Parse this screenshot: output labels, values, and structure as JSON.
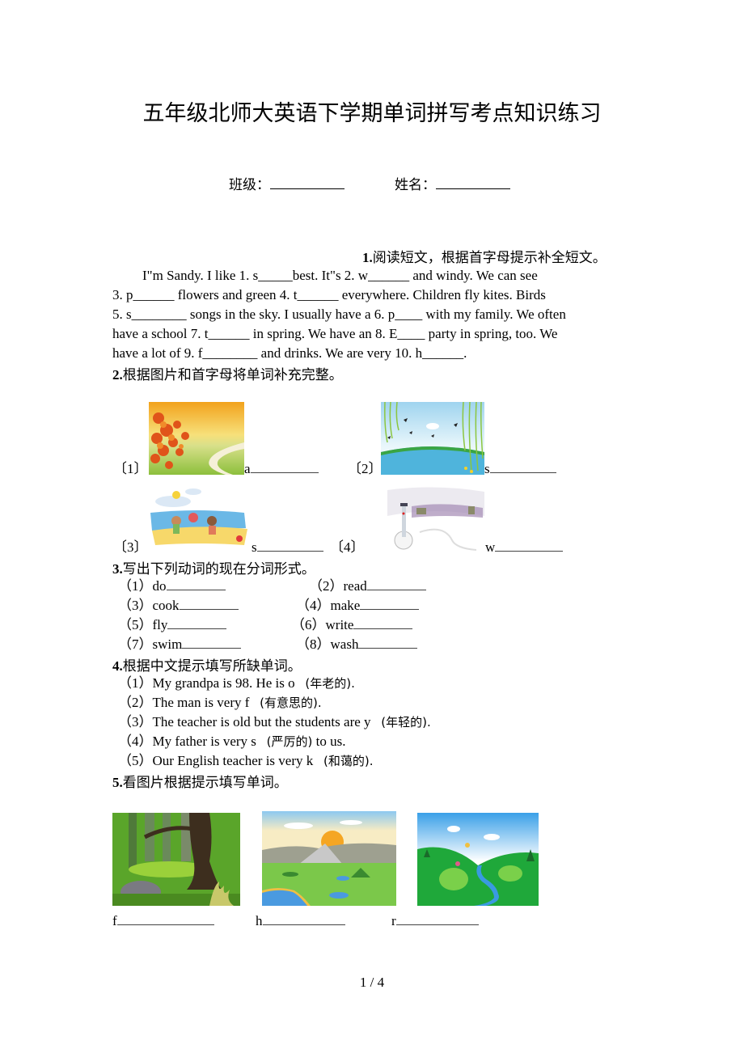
{
  "title": "五年级北师大英语下学期单词拼写考点知识练习",
  "info": {
    "class_label": "班级：",
    "name_label": "姓名："
  },
  "q1": {
    "number": "1.",
    "heading": "阅读短文，根据首字母提示补全短文。",
    "lines": [
      "I\"m Sandy. I like 1. s_____best. It\"s 2. w______  and windy. We can see",
      "3. p______ flowers and green 4. t______ everywhere. Children fly kites. Birds",
      "5. s________ songs in the sky. I usually have a 6. p____ with my family. We often",
      "have a school 7. t______ in spring. We have an 8. E____ party in spring, too. We",
      "have a lot of 9. f________ and drinks. We are very 10. h______."
    ]
  },
  "q2": {
    "number": "2.",
    "heading": "根据图片和首字母将单词补充完整。",
    "items": [
      {
        "label": "〔1〕",
        "letter": "a",
        "picture": "autumn-scene-picture"
      },
      {
        "label": "〔2〕",
        "letter": "s",
        "picture": "spring-scene-picture"
      },
      {
        "label": "〔3〕",
        "letter": "s",
        "picture": "summer-beach-picture"
      },
      {
        "label": "〔4〕",
        "letter": "w",
        "picture": "winter-snowman-picture"
      }
    ]
  },
  "q3": {
    "number": "3.",
    "heading": "写出下列动词的现在分词形式。",
    "items": [
      {
        "label": "（1）",
        "word": "do"
      },
      {
        "label": "（2）",
        "word": "read"
      },
      {
        "label": "（3）",
        "word": "cook"
      },
      {
        "label": "（4）",
        "word": "make"
      },
      {
        "label": "（5）",
        "word": "fly"
      },
      {
        "label": "（6）",
        "word": "write"
      },
      {
        "label": "（7）",
        "word": "swim"
      },
      {
        "label": "（8）",
        "word": "wash"
      }
    ]
  },
  "q4": {
    "number": "4.",
    "heading": "根据中文提示填写所缺单词。",
    "items": [
      {
        "label": "（1）",
        "text": "My grandpa is 98. He is o",
        "hint": "(年老的).",
        "tail": ""
      },
      {
        "label": "（2）",
        "text": "The man is very f",
        "hint": "(有意思的).",
        "tail": ""
      },
      {
        "label": "（3）",
        "text": "The teacher is old but the students are y",
        "hint": "(年轻的).",
        "tail": ""
      },
      {
        "label": "（4）",
        "text": "My father is very s",
        "hint": "(严厉的)",
        "tail": " to us."
      },
      {
        "label": "（5）",
        "text": "Our English teacher is very k",
        "hint": "(和蔼的).",
        "tail": ""
      }
    ]
  },
  "q5": {
    "number": "5.",
    "heading": "看图片根据提示填写单词。",
    "items": [
      {
        "letter": "f",
        "picture": "forest-picture"
      },
      {
        "letter": "h",
        "picture": "hill-picture"
      },
      {
        "letter": "r",
        "picture": "river-picture"
      }
    ]
  },
  "footer": {
    "page": "1 / 4"
  }
}
